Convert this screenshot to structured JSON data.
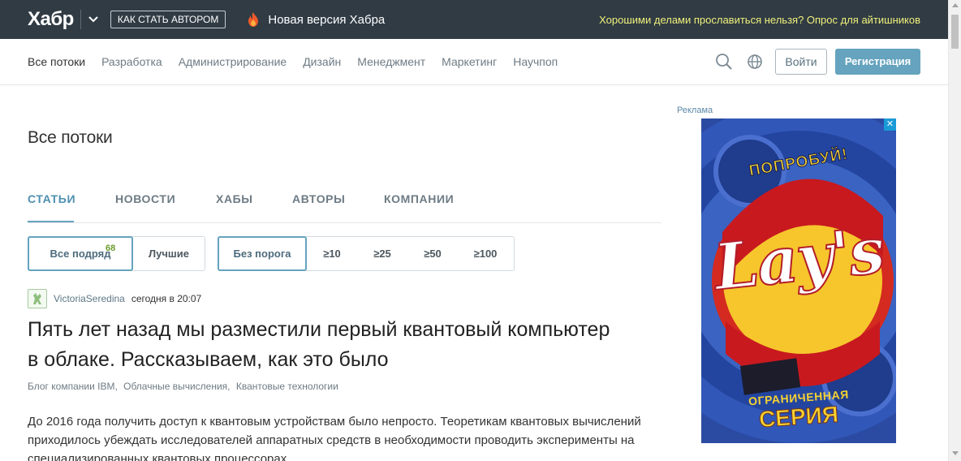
{
  "header": {
    "logo": "Хабр",
    "author_button": "КАК СТАТЬ АВТОРОМ",
    "new_version": "Новая версия Хабра",
    "promo": "Хорошими делами прославиться нельзя? Опрос для айтишников"
  },
  "nav": {
    "items": [
      "Все потоки",
      "Разработка",
      "Администрирование",
      "Дизайн",
      "Менеджмент",
      "Маркетинг",
      "Научпоп"
    ],
    "login": "Войти",
    "register": "Регистрация"
  },
  "main": {
    "title": "Все потоки",
    "tabs": [
      "СТАТЬИ",
      "НОВОСТИ",
      "ХАБЫ",
      "АВТОРЫ",
      "КОМПАНИИ"
    ],
    "filters1": [
      "Все подряд",
      "Лучшие"
    ],
    "all_count": "68",
    "filters2": [
      "Без порога",
      "≥10",
      "≥25",
      "≥50",
      "≥100"
    ]
  },
  "post": {
    "author": "VictoriaSeredina",
    "time": "сегодня в 20:07",
    "title": "Пять лет назад мы разместили первый квантовый компьютер в облаке. Рассказываем, как это было",
    "hubs": [
      "Блог компании IBM,",
      "Облачные вычисления,",
      "Квантовые технологии"
    ],
    "text": "До 2016 года получить доступ к квантовым устройствам было непросто. Теоретикам квантовых вычислений приходилось убеждать исследователей аппаратных средств в необходимости проводить эксперименты на специализированных квантовых процессорах."
  },
  "ad": {
    "label": "Реклама",
    "close": "✕",
    "top": "ПОПРОБУЙ!",
    "brand": "Lay's",
    "bottom_line1": "ОГРАНИЧЕННАЯ",
    "bottom_line2": "СЕРИЯ"
  },
  "colors": {
    "topbar": "#303b44",
    "accent": "#65a3be",
    "promo": "#f0f07a"
  }
}
